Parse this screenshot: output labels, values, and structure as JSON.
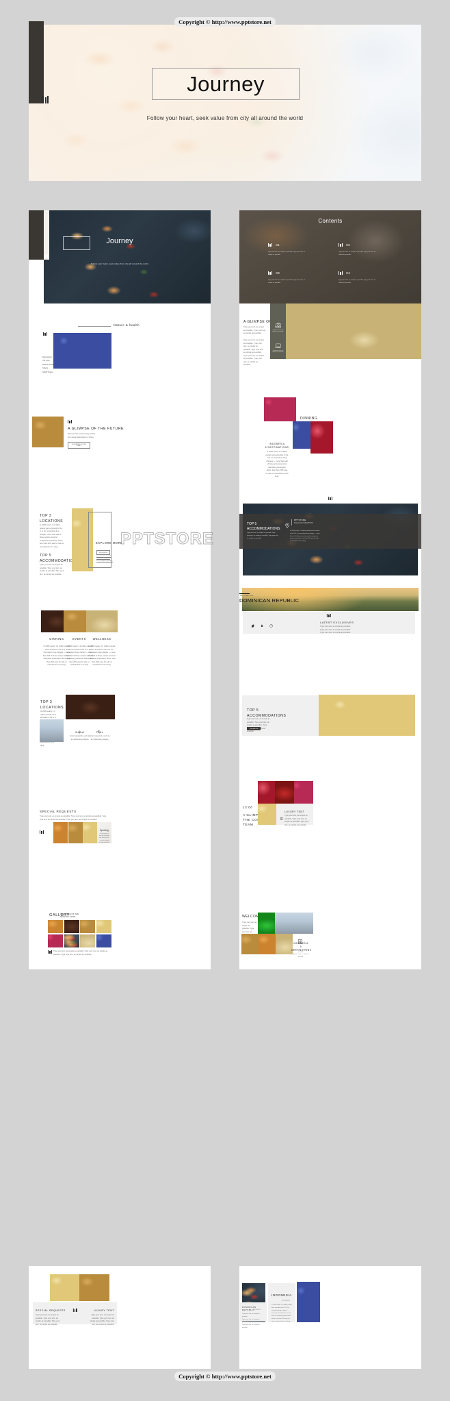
{
  "copyright": "Copyright © http://www.pptstore.net",
  "watermark": "PPTSTORE",
  "hero": {
    "title": "Journey",
    "subtitle": "Follow your heart, seek value from city all around the world"
  },
  "slides": [
    {
      "name": "cover-thumbnail",
      "title": "Journey",
      "subtitle": "Follow your heart, seek value from city all around the world"
    },
    {
      "name": "contents",
      "title": "Contents",
      "items": [
        {
          "num": "01",
          "text": "Type your text, as simple as possible. Type your text, as simple as possible."
        },
        {
          "num": "02",
          "text": "Type your text, as simple as possible. Type your text, as simple as possible."
        },
        {
          "num": "03",
          "text": "Type your text, as simple as possible. Type your text, as simple as possible."
        },
        {
          "num": "04",
          "text": "Type your text, as simple as possible. Type your text, as simple as possible."
        }
      ]
    },
    {
      "name": "nature-health",
      "kicker": "Nature & health",
      "menu": [
        "Reservation",
        "VIP room",
        "Recommendation",
        "School",
        "SHOP Online"
      ]
    },
    {
      "name": "glimpse-of-the-past",
      "title": "A GLIMPSE OF THE PAST",
      "lead": "Type your text, as simple as possible. Type your text, as simple as possible.",
      "body": "Type your text, as simple as possible. Type your text, as simple as possible. Type your text, as simple as possible. Type your text, as simple as possible. Type your text, as simple as possible.",
      "side_items": [
        {
          "icon": "camera-icon",
          "label": "Camera",
          "text": "Type your text, as simple as possible."
        },
        {
          "icon": "monitor-icon",
          "label": "Screen",
          "text": "Type your text, as simple as possible."
        }
      ]
    },
    {
      "name": "glimpse-of-the-future",
      "title": "A GLIMPSE OF THE FUTURE",
      "body": "Discover the ancient story behind the newest destination in China.",
      "button": "A GLIMPSE OF THE PAST"
    },
    {
      "name": "dinning",
      "title": "DINNING",
      "body": "In 2009 nearly 1.3 million people were arrested in the U.S. for nonviolent drug charges — more than half of those arrests were for marijuana possession alone, less than 20% was for sale or manufacture of a drug.",
      "subtitle": "INDONESIA\n5 DESTINATIONS",
      "subbody": "In 2009 nearly 1.3 million people were arrested in the U.S. for nonviolent drug charges — more than half of those arrests were for marijuana possession alone, less than 20% was for sale or manufacture of a drug."
    },
    {
      "name": "top3-locations",
      "title1": "TOP 3\nLOCATIONS",
      "body1": "In 2009 nearly 1.3 million people were arrested in the U.S. for nonviolent drug charges, more than half of those arrests were for marijuana possession alone, less than 20% was for sale or manufacture of a drug.",
      "title2": "TOP 5\nACCOMMODATIONS",
      "body2": "Type your text, as simple as possible. Type your text, as simple as possible. Type your text, as simple as possible.",
      "explore": "EXPLORE MORE",
      "tag": "Fun and rich",
      "link": "Type your text, as simple as possible. Type your text, as simple as possible."
    },
    {
      "name": "top5-accommodations-dark",
      "title": "TOP 5\nACCOMMODATIONS",
      "body": "Type your text, as simple as possible. Type your text, as simple as possible. Type your text, as simple as possible.",
      "meta_title": "PPTSTORE",
      "meta_sub": "Powered by SUN_PPT-01",
      "meta_body": "In 2009 nearly 1.3 million people were arrested in the U.S. for nonviolent drug charges — more than half of those arrests were for marijuana possession alone, less than 20% was for sale or manufacture of a drug."
    },
    {
      "name": "three-categories",
      "columns": [
        {
          "label": "DINNING",
          "text": "In 2009 nearly 1.3 million people were arrested in the U.S. for nonviolent drug charges — more than half of those arrests were for marijuana possession alone, less than 20% was for sale or manufacture of a drug."
        },
        {
          "label": "EVENTS",
          "text": "In 2009 nearly 1.3 million people were arrested in the U.S. for nonviolent drug charges — more than half of those arrests were for marijuana possession alone, less than 20% was for sale or manufacture of a drug."
        },
        {
          "label": "WELLNESS",
          "text": "In 2009 nearly 1.3 million people were arrested in the U.S. for nonviolent drug charges — more than half of those arrests were for marijuana possession alone, less than 20% was for sale or manufacture of a drug."
        }
      ]
    },
    {
      "name": "dominican-republic",
      "kicker": "DESTINATION",
      "title": "DOMINICAN REPUBLIC",
      "section": "LATEST EXCLUSIVES",
      "body": "Type your text, as simple as possible. Type your text, as simple as possible. Type your text, as simple as possible.",
      "icons": [
        "leaf-icon",
        "fire-icon",
        "clock-icon"
      ]
    },
    {
      "name": "top3-locations-market-price",
      "title": "TOP 3\nLOCATIONS",
      "body": "In 2009 nearly 1.3 million people were arrested in the U.S. for nonviolent drug charges — more than half of those arrests were for marijuana possession alone, less than 20% was for sale or manufacture of a drug.",
      "features": [
        {
          "icon": "gear-icon",
          "label": "Market",
          "text": "Enter keywords, such as an advertising slogan."
        },
        {
          "icon": "tag-icon",
          "label": "Price",
          "text": "Enter keywords, such as an advertising slogan."
        }
      ]
    },
    {
      "name": "top5-accommodations-light",
      "title": "TOP 5\nACCOMMODATIONS",
      "body": "Type your text, as simple as possible. Type your text, as simple as possible. Type your text, as simple as possible.",
      "tag": "Fun and rich"
    },
    {
      "name": "special-requests-gallery",
      "title": "SPECIAL REQUESTS",
      "body": "Type your text, as simple as possible. Type your text, as simple as possible. Type your text, as simple as possible. Type your text, as simple as possible.",
      "card_title": "Sporting",
      "card_body": "Find experience through knowledge and share service, over the earning provides a platform."
    },
    {
      "name": "cool-team",
      "time": "13:00",
      "title": "A GLIMPSE OF\nTHE COOL\nTEAM",
      "section": "LUXURY TENT",
      "body": "Type your text, as simple as possible. Type your text, as simple as possible. Type your text, as simple as possible."
    },
    {
      "name": "gallery",
      "title": "GALLERY",
      "subtitle": "A GLIMPSE OF THE\nHEALTHY FOOD",
      "footer": "Type your text, as simple as possible. Type your text, as simple as possible. Type your text, as simple as possible."
    },
    {
      "name": "welcome",
      "title": "WELCOME",
      "body": "Type your text, as simple as possible. Type your text, as simple as possible. Type your text, as simple as possible.",
      "side_title": "INDONESIA\n5 DESTINATIONS",
      "side_body": "Type your text, as simple as possible.\nType your text, as simple as possible."
    },
    {
      "name": "special-requests-luxury-tent",
      "left_title": "SPECIAL REQUESTS",
      "left_body": "Type your text, as simple as possible. Type your text, as simple as possible. Type your text, as simple as possible.",
      "right_title": "LUXURY TENT",
      "right_body": "Type your text, as simple as possible. Type your text, as simple as possible. Type your text, as simple as possible."
    },
    {
      "name": "indonesia",
      "title": "INDONESIA",
      "subtitle": "DESTINATION",
      "body": "In 2009 nearly 1.3 million people were arrested in the U.S. for nonviolent drug charges — more than half of those arrests were for marijuana possession alone, less than 20% was for sale or manufacture of a drug.",
      "card_title": "DOMINICAN REPUBLIC",
      "card_sub": "DESTINATION",
      "card_body": "Type your text, as simple as possible.\nType your text, as simple as possible.\nType your text, as simple as possible."
    }
  ]
}
